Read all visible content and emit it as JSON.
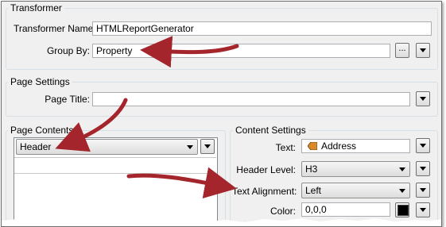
{
  "transformer": {
    "title": "Transformer",
    "name_label": "Transformer Name:",
    "name_value": "HTMLReportGenerator",
    "group_by_label": "Group By:",
    "group_by_value": "Property",
    "ellipsis_label": "..."
  },
  "page_settings": {
    "title": "Page Settings",
    "page_title_label": "Page Title:",
    "page_title_value": ""
  },
  "page_contents": {
    "title": "Page Contents",
    "selected": "Header"
  },
  "content_settings": {
    "title": "Content Settings",
    "text_label": "Text:",
    "text_value": "Address",
    "header_level_label": "Header Level:",
    "header_level_value": "H3",
    "text_alignment_label": "Text Alignment:",
    "text_alignment_value": "Left",
    "color_label": "Color:",
    "color_value": "0,0,0",
    "color_swatch": "#000000"
  },
  "colors": {
    "annotation_arrow": "#a4262c",
    "panel_background": "#f0f0f0"
  },
  "icons": {
    "text_attribute": "attribute-tag-icon",
    "dropdown": "chevron-down-icon"
  }
}
